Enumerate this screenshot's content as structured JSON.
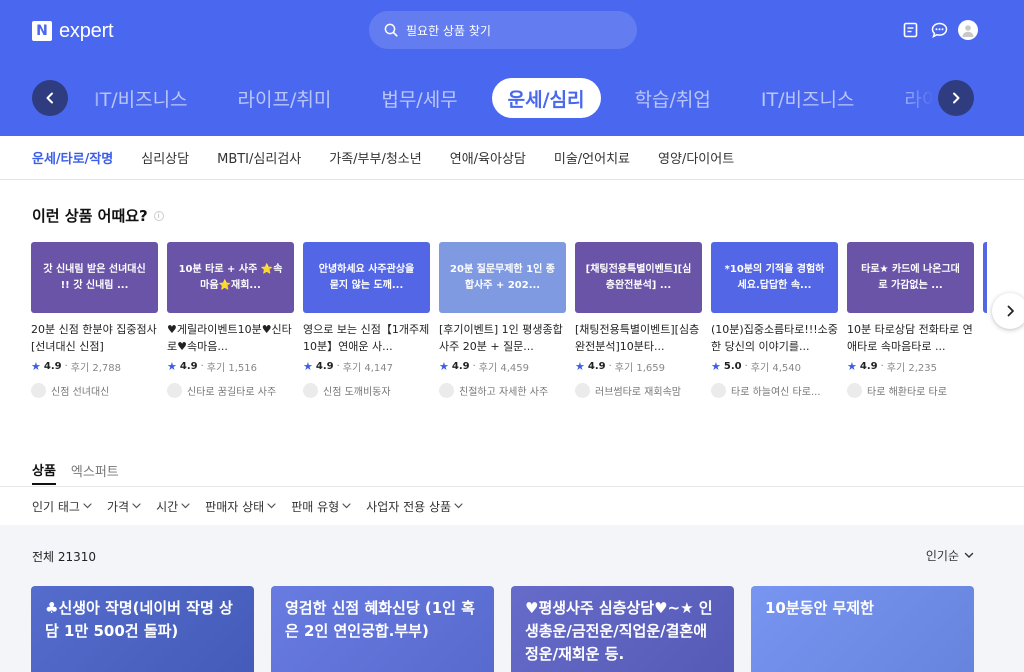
{
  "header": {
    "logo_mark": "N",
    "logo_text": "expert",
    "search_placeholder": "필요한 상품 찾기",
    "icons": [
      "document-icon",
      "chat-icon",
      "avatar"
    ]
  },
  "categories": {
    "items": [
      "IT/비즈니스",
      "라이프/취미",
      "법무/세무",
      "운세/심리",
      "학습/취업",
      "IT/비즈니스",
      "라이프/취미"
    ],
    "active_index": 3
  },
  "subnav": {
    "items": [
      "운세/타로/작명",
      "심리상담",
      "MBTI/심리검사",
      "가족/부부/청소년",
      "연애/육아상담",
      "미술/언어치료",
      "영양/다이어트"
    ],
    "active_index": 0
  },
  "recommend": {
    "title": "이런 상품 어때요?",
    "cards": [
      {
        "thumb": "갓 신내림 받은 선녀대신 !! 갓 신내림 ...",
        "color": "#6a54a8",
        "title": "20분 신점 한분야 집중점사 [선녀대신 신점]",
        "rating": "4.9",
        "reviews": "후기 2,788",
        "seller": "신점 선녀대신"
      },
      {
        "thumb": "10분 타로 + 사주 ⭐속마음⭐재회...",
        "color": "#6a54a8",
        "title": "♥게릴라이벤트10분♥신타로♥속마음...",
        "rating": "4.9",
        "reviews": "후기 1,516",
        "seller": "신타로 꿈길타로 사주"
      },
      {
        "thumb": "안녕하세요 사주관상을 묻지 않는 도깨...",
        "color": "#5266e6",
        "title": "영으로 보는 신점【1개주제 10분】연애운 사...",
        "rating": "4.9",
        "reviews": "후기 4,147",
        "seller": "신점 도깨비동자"
      },
      {
        "thumb": "20분 질문무제한 1인 종합사주 + 202...",
        "color": "#7f9ae0",
        "title": "[후기이벤트] 1인 평생종합사주 20분 + 질문...",
        "rating": "4.9",
        "reviews": "후기 4,459",
        "seller": "친절하고 자세한 사주"
      },
      {
        "thumb": "[채팅전용특별이벤트][심층완전분석] ...",
        "color": "#6a54a8",
        "title": "[채팅전용특별이벤트][심층완전분석]10분타...",
        "rating": "4.9",
        "reviews": "후기 1,659",
        "seller": "러브썸타로 재회속맘"
      },
      {
        "thumb": "*10분의 기적을 경험하세요.답답한 속...",
        "color": "#5266e6",
        "title": "(10분)집중소름타로!!!소중한 당신의 이야기를...",
        "rating": "5.0",
        "reviews": "후기 4,540",
        "seller": "타로 하늘여신 타로..."
      },
      {
        "thumb": "타로★ 카드에 나온그대로 가감없는 ...",
        "color": "#6a54a8",
        "title": "10분 타로상담 전화타로 연애타로 속마음타로 ...",
        "rating": "4.9",
        "reviews": "후기 2,235",
        "seller": "타로 해환타로 타로"
      }
    ]
  },
  "product_tabs": {
    "items": [
      "상품",
      "엑스퍼트"
    ],
    "active_index": 0
  },
  "filters": [
    "인기 태그",
    "가격",
    "시간",
    "판매자 상태",
    "판매 유형",
    "사업자 전용 상품"
  ],
  "list": {
    "total_label": "전체 21310",
    "sort_label": "인기순",
    "products": [
      {
        "title": "♣신생아 작명(네이버 작명 상담 1만 500건 돌파)",
        "color": "#4a63c9"
      },
      {
        "title": "영검한 신점 혜화신당 (1인 혹은 2인 연인궁합.부부)",
        "color": "#5f73df"
      },
      {
        "title": "♥평생사주 심층상담♥~★ 인생총운/금전운/직업운/결혼애정운/재회운 등.",
        "color": "#5d62c6"
      },
      {
        "title": "10분동안 무제한",
        "color": "#6f8ff0"
      }
    ]
  },
  "colors": {
    "brand": "#4a68ef",
    "accent": "#3b5de7"
  }
}
